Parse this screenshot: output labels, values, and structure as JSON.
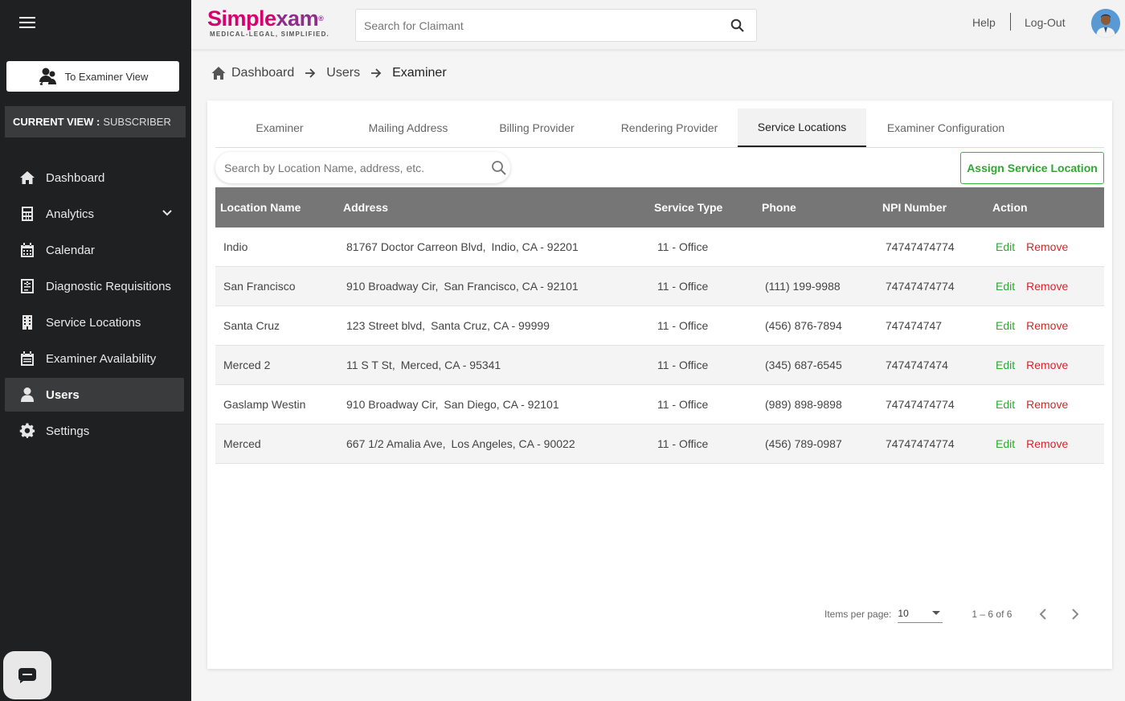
{
  "sidebar": {
    "examiner_view_label": "To Examiner View",
    "current_view_key": "CURRENT VIEW :",
    "current_view_value": "SUBSCRIBER",
    "items": [
      {
        "label": "Dashboard",
        "icon": "home-icon"
      },
      {
        "label": "Analytics",
        "icon": "calculator-icon"
      },
      {
        "label": "Calendar",
        "icon": "calendar-icon"
      },
      {
        "label": "Diagnostic Requisitions",
        "icon": "requisition-icon"
      },
      {
        "label": "Service Locations",
        "icon": "building-icon"
      },
      {
        "label": "Examiner Availability",
        "icon": "calendar-check-icon"
      },
      {
        "label": "Users",
        "icon": "user-icon"
      },
      {
        "label": "Settings",
        "icon": "gear-icon"
      }
    ]
  },
  "header": {
    "brand_main": "Simple",
    "brand_accent": "xam",
    "brand_mark": "®",
    "tagline": "MEDICAL-LEGAL, SIMPLIFIED.",
    "search_placeholder": "Search for Claimant",
    "help": "Help",
    "logout": "Log-Out"
  },
  "breadcrumb": {
    "items": [
      "Dashboard",
      "Users",
      "Examiner"
    ]
  },
  "tabs": [
    "Examiner",
    "Mailing Address",
    "Billing Provider",
    "Rendering Provider",
    "Service Locations",
    "Examiner Configuration"
  ],
  "active_tab": "Service Locations",
  "location_search_placeholder": "Search by Location Name, address, etc.",
  "assign_button": "Assign Service Location",
  "table": {
    "columns": [
      "Location Name",
      "Address",
      "Service Type",
      "Phone",
      "NPI Number",
      "Action"
    ],
    "rows": [
      {
        "name": "Indio",
        "street": "81767 Doctor Carreon Blvd,",
        "city": "Indio, CA - 92201",
        "service": "11 - Office",
        "phone": "",
        "npi": "74747474774"
      },
      {
        "name": "San Francisco",
        "street": "910 Broadway Cir,",
        "city": "San Francisco, CA - 92101",
        "service": "11 - Office",
        "phone": "(111) 199-9988",
        "npi": "74747474774"
      },
      {
        "name": "Santa Cruz",
        "street": "123 Street blvd,",
        "city": "Santa Cruz, CA - 99999",
        "service": "11 - Office",
        "phone": "(456) 876-7894",
        "npi": "747474747"
      },
      {
        "name": "Merced 2",
        "street": "11 S T St,",
        "city": "Merced, CA - 95341",
        "service": "11 - Office",
        "phone": "(345) 687-6545",
        "npi": "7474747474"
      },
      {
        "name": "Gaslamp Westin",
        "street": "910 Broadway Cir,",
        "city": "San Diego, CA - 92101",
        "service": "11 - Office",
        "phone": "(989) 898-9898",
        "npi": "74747474774"
      },
      {
        "name": "Merced",
        "street": "667 1/2 Amalia Ave,",
        "city": "Los Angeles, CA - 90022",
        "service": "11 - Office",
        "phone": "(456) 789-0987",
        "npi": "74747474774"
      }
    ],
    "edit_label": "Edit",
    "remove_label": "Remove"
  },
  "pagination": {
    "items_per_page_label": "Items per page:",
    "items_per_page": "10",
    "range": "1 – 6 of 6"
  },
  "colors": {
    "sidebar_bg": "#1f2021",
    "accent_green": "#2ea832",
    "remove_red": "#d0262a",
    "table_header": "#767676",
    "brand_pink": "#d6006f",
    "brand_purple": "#8e2d8c"
  }
}
